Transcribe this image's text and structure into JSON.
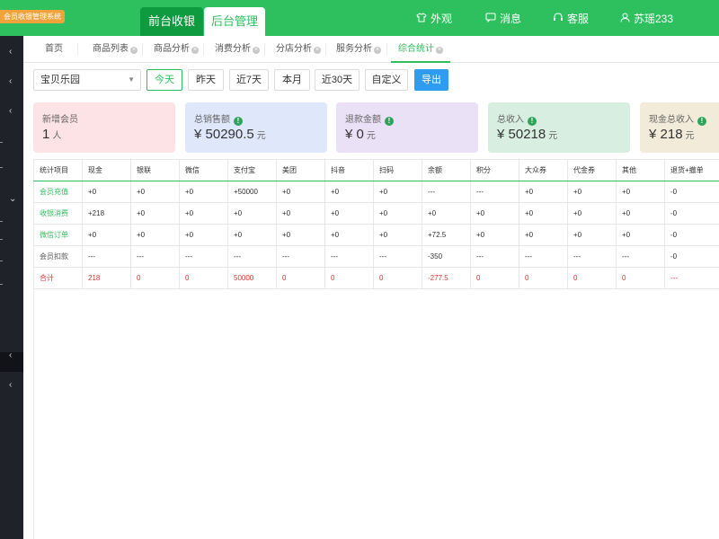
{
  "app": {
    "brand": "会员收银管理系统",
    "top_tabs": {
      "front": "前台收银",
      "back": "后台管理"
    },
    "top_right": {
      "appearance": "外观",
      "messages": "消息",
      "service": "客服",
      "user": "苏瑶233"
    }
  },
  "nav_tabs": [
    "首页",
    "商品列表",
    "商品分析",
    "消费分析",
    "分店分析",
    "服务分析",
    "综合统计"
  ],
  "filter": {
    "store": "宝贝乐园",
    "buttons": [
      "今天",
      "昨天",
      "近7天",
      "本月",
      "近30天",
      "自定义"
    ],
    "export": "导出"
  },
  "cards": [
    {
      "label": "新增会员",
      "value": "1",
      "unit": "人",
      "currency": "",
      "color": "#fde3e6"
    },
    {
      "label": "总销售额",
      "value": "50290.5",
      "unit": "元",
      "currency": "¥",
      "color": "#dfe8fb"
    },
    {
      "label": "退款金额",
      "value": "0",
      "unit": "元",
      "currency": "¥",
      "color": "#ebe1f7"
    },
    {
      "label": "总收入",
      "value": "50218",
      "unit": "元",
      "currency": "¥",
      "color": "#d8eee1"
    },
    {
      "label": "现金总收入",
      "value": "218",
      "unit": "元",
      "currency": "¥",
      "color": "#f2ebd9"
    }
  ],
  "table": {
    "headers": [
      "统计项目",
      "现金",
      "银联",
      "微信",
      "支付宝",
      "美团",
      "抖音",
      "扫码",
      "余额",
      "积分",
      "大众券",
      "代金券",
      "其他",
      "退货+撤单"
    ],
    "rows": [
      [
        "会员充值",
        "+0",
        "+0",
        "+0",
        "+50000",
        "+0",
        "+0",
        "+0",
        "---",
        "---",
        "+0",
        "+0",
        "+0",
        "-0"
      ],
      [
        "收银消费",
        "+218",
        "+0",
        "+0",
        "+0",
        "+0",
        "+0",
        "+0",
        "+0",
        "+0",
        "+0",
        "+0",
        "+0",
        "-0"
      ],
      [
        "微信订单",
        "+0",
        "+0",
        "+0",
        "+0",
        "+0",
        "+0",
        "+0",
        "+72.5",
        "+0",
        "+0",
        "+0",
        "+0",
        "-0"
      ],
      [
        "会员扣款",
        "---",
        "---",
        "---",
        "---",
        "---",
        "---",
        "---",
        "-350",
        "---",
        "---",
        "---",
        "---",
        "-0"
      ],
      [
        "合计",
        "218",
        "0",
        "0",
        "50000",
        "0",
        "0",
        "0",
        "-277.5",
        "0",
        "0",
        "0",
        "0",
        "---"
      ]
    ]
  },
  "colors": {
    "primary": "#2ec05f",
    "front_tab": "#0e9a3f",
    "sidebar": "#20222a",
    "export": "#2f9cf0",
    "total": "#e03030",
    "brand": "#f1a33b"
  }
}
